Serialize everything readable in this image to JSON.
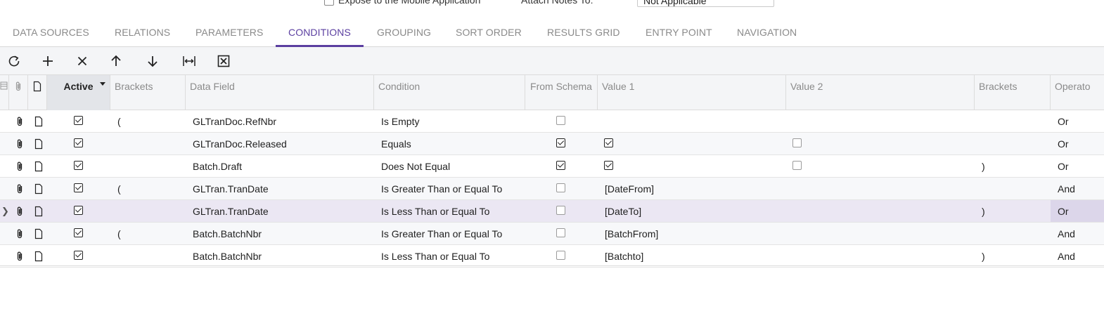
{
  "top": {
    "expose_label": "Expose to the Mobile Application",
    "attach_notes_label": "Attach Notes To:",
    "attach_notes_value": "Not Applicable"
  },
  "tabs": [
    {
      "label": "DATA SOURCES",
      "active": false
    },
    {
      "label": "RELATIONS",
      "active": false
    },
    {
      "label": "PARAMETERS",
      "active": false
    },
    {
      "label": "CONDITIONS",
      "active": true
    },
    {
      "label": "GROUPING",
      "active": false
    },
    {
      "label": "SORT ORDER",
      "active": false
    },
    {
      "label": "RESULTS GRID",
      "active": false
    },
    {
      "label": "ENTRY POINT",
      "active": false
    },
    {
      "label": "NAVIGATION",
      "active": false
    }
  ],
  "toolbar": {
    "buttons": [
      "refresh-icon",
      "add-icon",
      "delete-icon",
      "move-up-icon",
      "move-down-icon",
      "fit-columns-icon",
      "export-excel-icon"
    ]
  },
  "grid": {
    "headers": {
      "active": "Active",
      "brackets_open": "Brackets",
      "data_field": "Data Field",
      "condition": "Condition",
      "from_schema": "From Schema",
      "value1": "Value 1",
      "value2": "Value 2",
      "brackets_close": "Brackets",
      "operator": "Operato"
    },
    "rows": [
      {
        "active": true,
        "open": "(",
        "field": "GLTranDoc.RefNbr",
        "condition": "Is Empty",
        "from_schema": false,
        "value1": "",
        "value1_check": null,
        "value2_check": null,
        "close": "",
        "operator": "Or",
        "selected": false
      },
      {
        "active": true,
        "open": "",
        "field": "GLTranDoc.Released",
        "condition": "Equals",
        "from_schema": true,
        "value1": "",
        "value1_check": true,
        "value2_check": false,
        "close": "",
        "operator": "Or",
        "selected": false
      },
      {
        "active": true,
        "open": "",
        "field": "Batch.Draft",
        "condition": "Does Not Equal",
        "from_schema": true,
        "value1": "",
        "value1_check": true,
        "value2_check": false,
        "close": ")",
        "operator": "Or",
        "selected": false
      },
      {
        "active": true,
        "open": "(",
        "field": "GLTran.TranDate",
        "condition": "Is Greater Than or Equal To",
        "from_schema": false,
        "value1": "[DateFrom]",
        "value1_check": null,
        "value2_check": null,
        "close": "",
        "operator": "And",
        "selected": false
      },
      {
        "active": true,
        "open": "",
        "field": "GLTran.TranDate",
        "condition": "Is Less Than or Equal To",
        "from_schema": false,
        "value1": "[DateTo]",
        "value1_check": null,
        "value2_check": null,
        "close": ")",
        "operator": "Or",
        "selected": true
      },
      {
        "active": true,
        "open": "(",
        "field": "Batch.BatchNbr",
        "condition": "Is Greater Than or Equal To",
        "from_schema": false,
        "value1": "[BatchFrom]",
        "value1_check": null,
        "value2_check": null,
        "close": "",
        "operator": "And",
        "selected": false
      },
      {
        "active": true,
        "open": "",
        "field": "Batch.BatchNbr",
        "condition": "Is Less Than or Equal To",
        "from_schema": false,
        "value1": "[Batchto]",
        "value1_check": null,
        "value2_check": null,
        "close": ")",
        "operator": "And",
        "selected": false
      }
    ]
  },
  "colors": {
    "accent": "#5b3fa0",
    "selected_row": "#ebe7f3",
    "header_bg": "#f4f5f7"
  }
}
